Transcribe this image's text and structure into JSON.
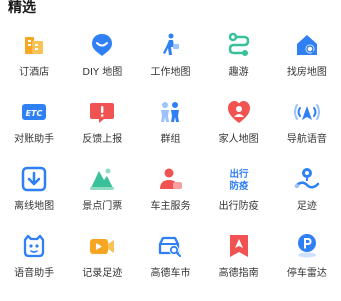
{
  "section": {
    "title": "精选"
  },
  "tiles": [
    {
      "label": "订酒店",
      "icon": "hotel-icon"
    },
    {
      "label": "DIY 地图",
      "icon": "diy-map-icon"
    },
    {
      "label": "工作地图",
      "icon": "work-map-icon"
    },
    {
      "label": "趣游",
      "icon": "trip-route-icon"
    },
    {
      "label": "找房地图",
      "icon": "house-search-icon"
    },
    {
      "label": "对账助手",
      "icon": "etc-icon"
    },
    {
      "label": "反馈上报",
      "icon": "feedback-icon"
    },
    {
      "label": "群组",
      "icon": "group-icon"
    },
    {
      "label": "家人地图",
      "icon": "family-map-icon"
    },
    {
      "label": "导航语音",
      "icon": "nav-voice-icon"
    },
    {
      "label": "离线地图",
      "icon": "offline-map-icon"
    },
    {
      "label": "景点门票",
      "icon": "scenic-ticket-icon"
    },
    {
      "label": "车主服务",
      "icon": "car-owner-icon"
    },
    {
      "label": "出行防疫",
      "icon": "travel-epidemic-icon"
    },
    {
      "label": "足迹",
      "icon": "footprint-icon"
    },
    {
      "label": "语音助手",
      "icon": "voice-assistant-icon"
    },
    {
      "label": "记录足迹",
      "icon": "record-footprint-icon"
    },
    {
      "label": "高德车市",
      "icon": "car-market-icon"
    },
    {
      "label": "高德指南",
      "icon": "guide-icon"
    },
    {
      "label": "停车雷达",
      "icon": "parking-radar-icon"
    }
  ],
  "icon_text": {
    "etc": "ETC",
    "epidemic_line1": "出行",
    "epidemic_line2": "防疫"
  },
  "colors": {
    "primary_blue": "#2f7ff5",
    "orange": "#f6a623",
    "red": "#f05352",
    "green": "#39c19b"
  }
}
